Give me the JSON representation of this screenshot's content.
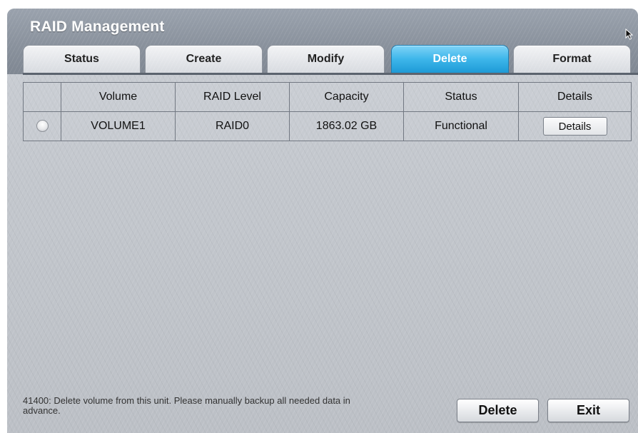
{
  "app": {
    "title": "RAID Management"
  },
  "tabs": [
    {
      "label": "Status",
      "active": false
    },
    {
      "label": "Create",
      "active": false
    },
    {
      "label": "Modify",
      "active": false
    },
    {
      "label": "Delete",
      "active": true
    },
    {
      "label": "Format",
      "active": false
    }
  ],
  "table": {
    "columns": [
      "",
      "Volume",
      "RAID Level",
      "Capacity",
      "Status",
      "Details"
    ],
    "rows": [
      {
        "selected": false,
        "volume": "VOLUME1",
        "raid_level": "RAID0",
        "capacity": "1863.02 GB",
        "status": "Functional",
        "details_button": "Details"
      }
    ]
  },
  "footer": {
    "message": "41400: Delete volume from this unit.  Please manually backup all needed data in advance.",
    "delete_label": "Delete",
    "exit_label": "Exit"
  },
  "colors": {
    "accent": "#3db6ea",
    "titlebar": "#8a929d",
    "panel": "#c3c7cd"
  },
  "icons": {
    "cursor": "mouse-pointer-icon",
    "row_select": "radio-button"
  }
}
